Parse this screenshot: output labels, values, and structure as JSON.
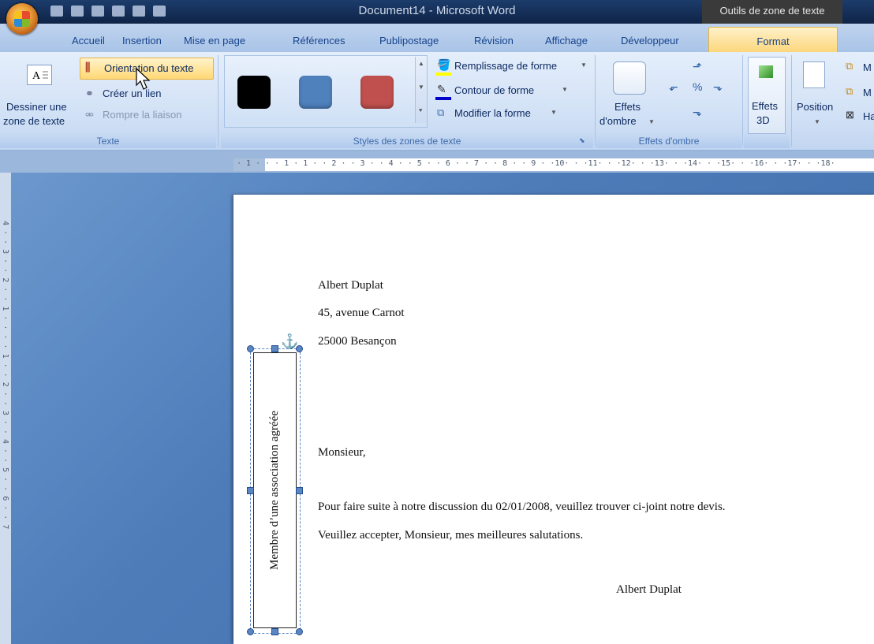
{
  "titlebar": {
    "document_title": "Document14 - Microsoft Word",
    "contextual_tab_group": "Outils de zone de texte"
  },
  "tabs": [
    "Accueil",
    "Insertion",
    "Mise en page",
    "Références",
    "Publipostage",
    "Révision",
    "Affichage",
    "Développeur",
    "Format"
  ],
  "active_tab": "Format",
  "ribbon": {
    "texte_group": {
      "dessiner_line1": "Dessiner une",
      "dessiner_line2": "zone de texte",
      "orientation": "Orientation du texte",
      "creer_lien": "Créer un lien",
      "rompre_liaison": "Rompre la liaison",
      "label": "Texte"
    },
    "styles_group": {
      "swatches": [
        "#000000",
        "#4f81bd",
        "#c0504d"
      ],
      "remplissage": "Remplissage de forme",
      "contour": "Contour de forme",
      "modifier": "Modifier la forme",
      "label": "Styles des zones de texte"
    },
    "ombre_group": {
      "effets_line1": "Effets",
      "effets_line2": "d'ombre",
      "label": "Effets d'ombre"
    },
    "effets3d_group": {
      "line1": "Effets",
      "line2": "3D"
    },
    "position_group": {
      "position": "Position",
      "item1": "M",
      "item2": "M",
      "item3": "Ha"
    }
  },
  "ruler": {
    "text": "· 1 · · · 1 · 1 · · 2 · · 3 · · 4 · · 5 · · 6 · · 7 · · 8 · · 9 · ·10· · ·11· · ·12· · ·13· · ·14· · ·15· · ·16· · ·17· · ·18·"
  },
  "vruler": {
    "text": "4 · · 3 · · 2 · · 1 · · · · 1 · · 2 · · 3 · · 4 · · 5 · · 6 · · 7"
  },
  "document": {
    "sender_name": "Albert Duplat",
    "sender_street": "45, avenue Carnot",
    "sender_city": "25000 Besançon",
    "salutation": "Monsieur,",
    "body1": "Pour faire suite à notre discussion du 02/01/2008, veuillez trouver ci-joint notre devis.",
    "body2": "Veuillez accepter, Monsieur, mes meilleures salutations.",
    "signature": "Albert Duplat",
    "textbox_text": "Membre d’une association agréée"
  }
}
